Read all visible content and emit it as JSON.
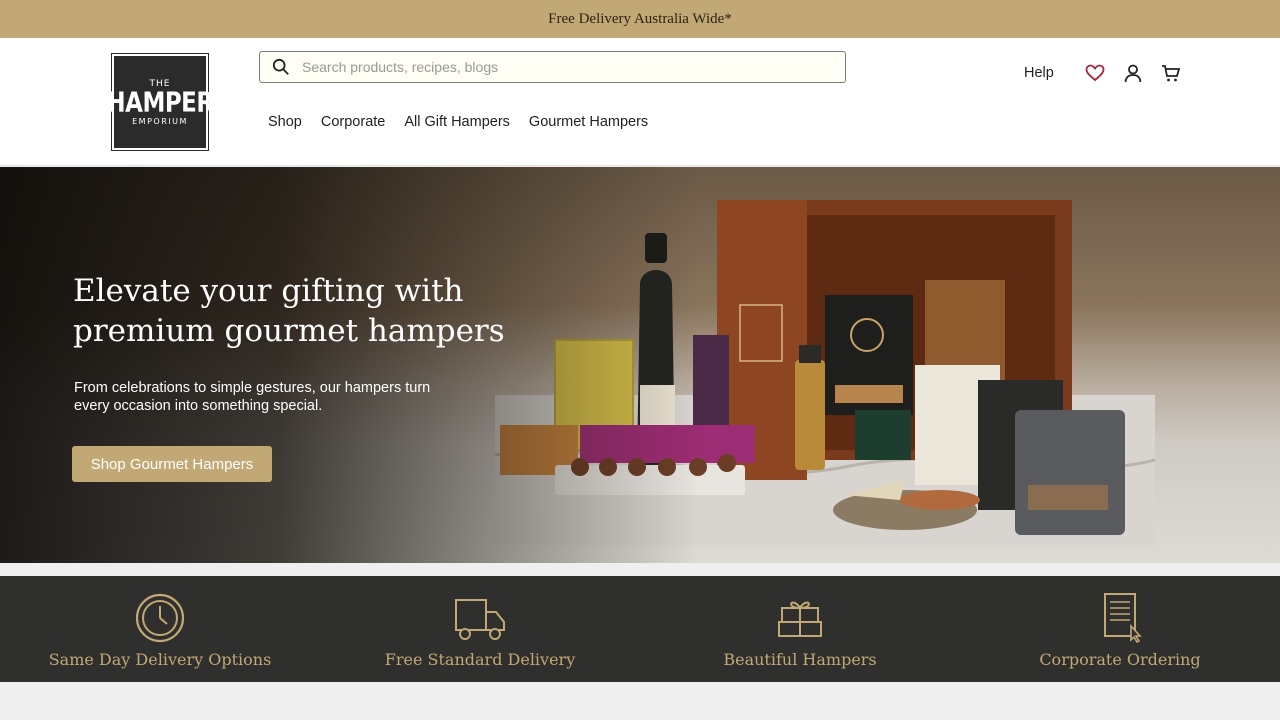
{
  "announcement": "Free Delivery Australia Wide*",
  "logo": {
    "line1": "THE",
    "line2": "HAMPER",
    "line3": "EMPORIUM"
  },
  "search": {
    "placeholder": "Search products, recipes, blogs"
  },
  "nav": [
    {
      "label": "Shop"
    },
    {
      "label": "Corporate"
    },
    {
      "label": "All Gift Hampers"
    },
    {
      "label": "Gourmet Hampers"
    }
  ],
  "actions": {
    "help": "Help",
    "icons": [
      "heart-icon",
      "user-icon",
      "cart-icon"
    ]
  },
  "hero": {
    "title": "Elevate your gifting with premium gourmet hampers",
    "subtitle": "From celebrations to simple gestures, our hampers turn every occasion into something special.",
    "cta": "Shop Gourmet Hampers"
  },
  "features": [
    {
      "label": "Same Day Delivery Options",
      "icon": "clock-icon"
    },
    {
      "label": "Free Standard Delivery",
      "icon": "truck-icon"
    },
    {
      "label": "Beautiful Hampers",
      "icon": "gift-icon"
    },
    {
      "label": "Corporate Ordering",
      "icon": "document-icon"
    }
  ],
  "colors": {
    "gold": "#c2a874",
    "dark": "#2f2f2d",
    "heart": "#a3293f"
  }
}
